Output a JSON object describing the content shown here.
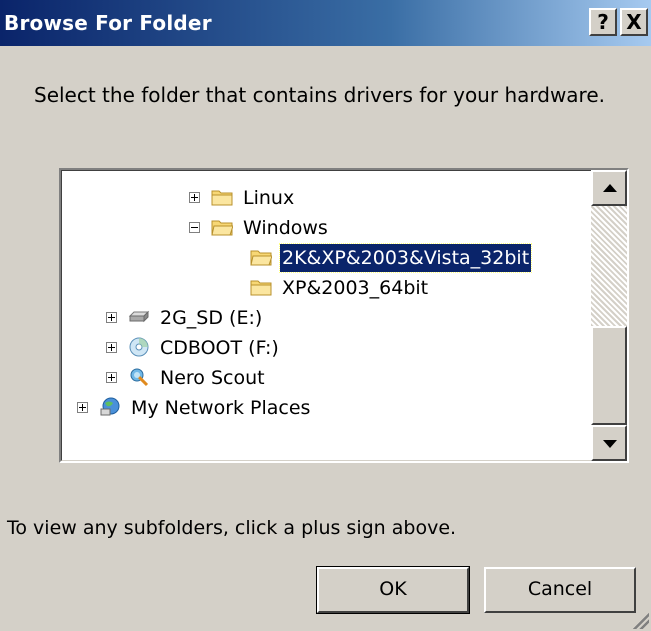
{
  "window": {
    "title": "Browse For Folder",
    "help_label": "?",
    "close_label": "X"
  },
  "instruction": "Select the folder that contains drivers for your hardware.",
  "tree": {
    "items": [
      {
        "label": "Linux",
        "icon": "folder-icon",
        "expander": "plus"
      },
      {
        "label": "Windows",
        "icon": "folder-open-icon",
        "expander": "minus"
      },
      {
        "label": "2K&XP&2003&Vista_32bit",
        "icon": "folder-open-icon",
        "expander": "none",
        "selected": true
      },
      {
        "label": "XP&2003_64bit",
        "icon": "folder-icon",
        "expander": "none"
      },
      {
        "label": "2G_SD (E:)",
        "icon": "removable-drive-icon",
        "expander": "plus"
      },
      {
        "label": "CDBOOT (F:)",
        "icon": "cd-drive-icon",
        "expander": "plus"
      },
      {
        "label": "Nero Scout",
        "icon": "nero-scout-icon",
        "expander": "plus"
      },
      {
        "label": "My Network Places",
        "icon": "network-places-icon",
        "expander": "plus"
      }
    ]
  },
  "footer_text": "To view any subfolders, click a plus sign above.",
  "buttons": {
    "ok": "OK",
    "cancel": "Cancel"
  },
  "colors": {
    "selection": "#0a246a",
    "title_start": "#0a246a",
    "title_end": "#a6caf0",
    "face": "#d4d0c8"
  }
}
